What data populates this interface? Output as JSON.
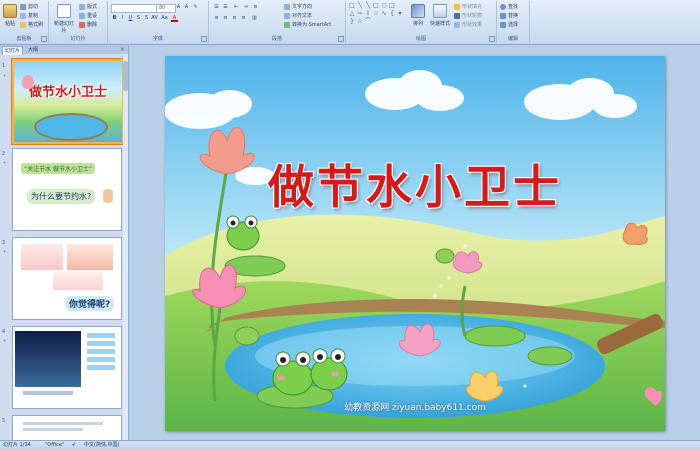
{
  "ribbon": {
    "clipboard": {
      "label": "剪贴板",
      "paste": "粘贴",
      "cut": "剪切",
      "copy": "复制",
      "format_painter": "格式刷"
    },
    "slides": {
      "label": "幻灯片",
      "new_slide": "新建幻灯片",
      "layout": "版式",
      "reset": "重设",
      "delete": "删除"
    },
    "font": {
      "label": "字体",
      "font_name": "",
      "font_size": "80"
    },
    "paragraph": {
      "label": "段落",
      "text_direction": "文字方向",
      "align_text": "对齐文本",
      "smartart": "转换为 SmartArt"
    },
    "drawing": {
      "label": "绘图",
      "arrange": "排列",
      "quick_styles": "快速样式",
      "shape_fill": "形状填充",
      "shape_outline": "形状轮廓",
      "shape_effects": "形状效果"
    },
    "editing": {
      "label": "编辑",
      "find": "查找",
      "replace": "替换",
      "select": "选择"
    }
  },
  "pane": {
    "tab_slides": "幻灯片",
    "tab_outline": "大纲",
    "close": "×",
    "slides": [
      {
        "number": "1",
        "title": "做节水小卫士"
      },
      {
        "number": "2",
        "line1": "“关注节水 做节水小卫士”",
        "line2": "为什么要节约水?"
      },
      {
        "number": "3",
        "line1": "你觉得呢?"
      },
      {
        "number": "4",
        "line1": ""
      },
      {
        "number": "5",
        "line1": ""
      }
    ]
  },
  "slide": {
    "title": "做节水小卫士",
    "footer": "幼教资源网 ziyuan.baby611.com"
  },
  "status": {
    "slide_info": "幻灯片 1/34",
    "theme": "\"Office\"",
    "language": "中文(简体,中国)"
  }
}
